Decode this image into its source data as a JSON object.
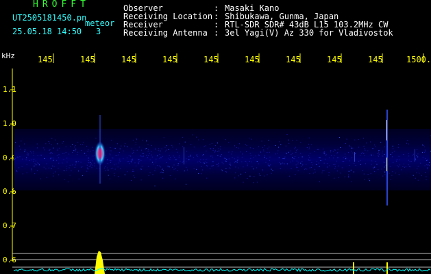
{
  "header": {
    "title": "HROFFT",
    "filename": "UT2505181450.pn",
    "meteor_label": "meteor",
    "datetime": "25.05.18 14:50",
    "count": "3",
    "fields": [
      {
        "label": "Observer",
        "value": "Masaki Kano"
      },
      {
        "label": "Receiving Location",
        "value": "Shibukawa, Gunma, Japan"
      },
      {
        "label": "Receiver",
        "value": "RTL-SDR SDR# 43dB L15 103.2MHz CW"
      },
      {
        "label": "Receiving Antenna",
        "value": "3el Yagi(V) Az 330 for Vladivostok"
      }
    ]
  },
  "axes": {
    "unit": "kHz",
    "x_ticks": [
      "145",
      "145",
      "145",
      "145",
      "145",
      "145",
      "145",
      "145",
      "145",
      "1500."
    ],
    "y_ticks": [
      "1.1",
      "1.0",
      "0.9",
      "0.8",
      "0.7",
      "0.6"
    ]
  },
  "colors": {
    "background": "#000000",
    "title": "#33ff33",
    "text": "#ffffff",
    "tick": "#ffff00",
    "noise": "#000066",
    "signal": "#ff3355",
    "baseline": "#00ffff"
  }
}
